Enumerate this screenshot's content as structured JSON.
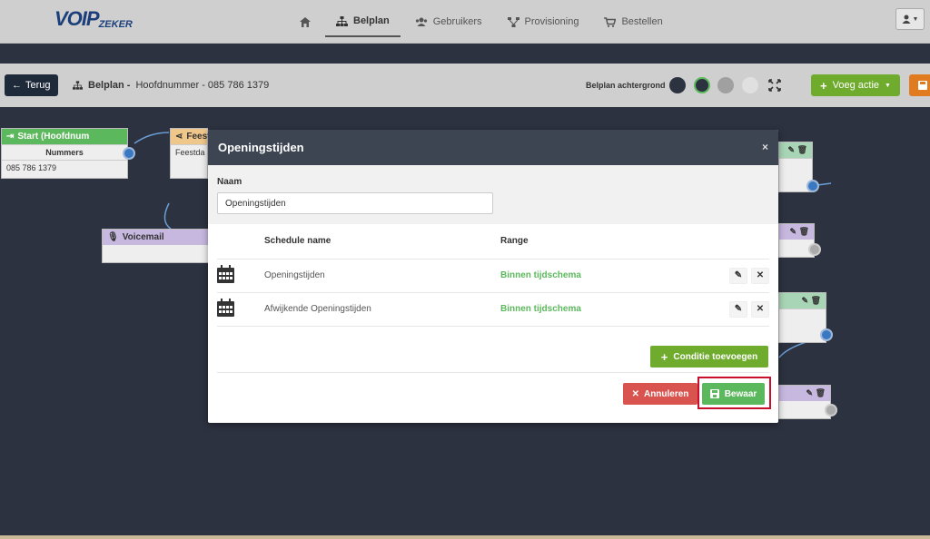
{
  "logo": {
    "voip": "VOIP",
    "zeker": "ZEKER"
  },
  "nav": {
    "items": [
      {
        "label": "",
        "icon": "home-icon"
      },
      {
        "label": "Belplan",
        "icon": "sitemap-icon"
      },
      {
        "label": "Gebruikers",
        "icon": "users-icon"
      },
      {
        "label": "Provisioning",
        "icon": "nodes-icon"
      },
      {
        "label": "Bestellen",
        "icon": "cart-icon"
      }
    ]
  },
  "toolbar": {
    "back_label": "Terug",
    "plan_label": "Belplan -",
    "plan_name": "Hoofdnummer - 085 786 1379",
    "background_label": "Belplan achtergrond",
    "swatches": [
      "#2d3240",
      "#2d3240",
      "#a0a0a0",
      "#e0e0e0"
    ],
    "add_action_label": "Voeg actie"
  },
  "canvas": {
    "start_node": {
      "title": "Start (Hoofdnum",
      "row1": "Nummers",
      "row2": "085 786 1379"
    },
    "feest_node": {
      "title": "Feest",
      "row1": "Feestda"
    },
    "voicemail_node": {
      "title": "Voicemail"
    }
  },
  "modal": {
    "title": "Openingstijden",
    "close_label": "×",
    "name_label": "Naam",
    "name_value": "Openingstijden",
    "table_headers": {
      "schedule": "Schedule name",
      "range": "Range"
    },
    "rows": [
      {
        "schedule": "Openingstijden",
        "range": "Binnen tijdschema"
      },
      {
        "schedule": "Afwijkende Openingstijden",
        "range": "Binnen tijdschema"
      }
    ],
    "add_condition_label": "Conditie toevoegen",
    "cancel_label": "Annuleren",
    "save_label": "Bewaar"
  },
  "colors": {
    "accent_green": "#6fab2d",
    "success": "#5cb85c",
    "danger": "#d9534f",
    "header_dark": "#3d4552"
  }
}
